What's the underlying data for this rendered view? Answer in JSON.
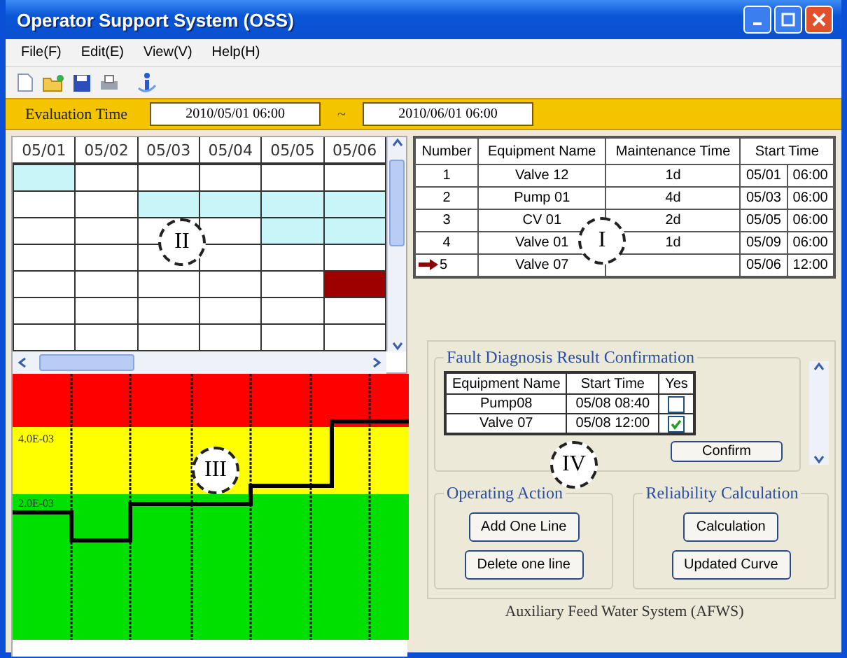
{
  "window": {
    "title": "Operator Support System (OSS)"
  },
  "menu": [
    "File(F)",
    "Edit(E)",
    "View(V)",
    "Help(H)"
  ],
  "evaluation": {
    "label": "Evaluation Time",
    "start": "2010/05/01 06:00",
    "separator": "~",
    "end": "2010/06/01 06:00"
  },
  "schedule": {
    "callout": "II",
    "columns": [
      "05/01",
      "05/02",
      "05/03",
      "05/04",
      "05/05",
      "05/06"
    ],
    "rows": [
      {
        "cells": [
          {
            "color": "#c8f5f7"
          },
          {
            "color": "#ffffff"
          },
          {
            "color": "#ffffff"
          },
          {
            "color": "#ffffff"
          },
          {
            "color": "#ffffff"
          },
          {
            "color": "#ffffff"
          }
        ]
      },
      {
        "cells": [
          {
            "color": "#ffffff"
          },
          {
            "color": "#ffffff"
          },
          {
            "color": "#c8f5f7"
          },
          {
            "color": "#c8f5f7"
          },
          {
            "color": "#c8f5f7"
          },
          {
            "color": "#c8f5f7"
          }
        ]
      },
      {
        "cells": [
          {
            "color": "#ffffff"
          },
          {
            "color": "#ffffff"
          },
          {
            "color": "#ffffff"
          },
          {
            "color": "#ffffff"
          },
          {
            "color": "#c8f5f7"
          },
          {
            "color": "#c8f5f7"
          }
        ]
      },
      {
        "cells": [
          {
            "color": "#ffffff"
          },
          {
            "color": "#ffffff"
          },
          {
            "color": "#ffffff"
          },
          {
            "color": "#ffffff"
          },
          {
            "color": "#ffffff"
          },
          {
            "color": "#ffffff"
          }
        ]
      },
      {
        "cells": [
          {
            "color": "#ffffff"
          },
          {
            "color": "#ffffff"
          },
          {
            "color": "#ffffff"
          },
          {
            "color": "#ffffff"
          },
          {
            "color": "#ffffff"
          },
          {
            "color": "#9e0000"
          }
        ]
      },
      {
        "cells": [
          {
            "color": "#ffffff"
          },
          {
            "color": "#ffffff"
          },
          {
            "color": "#ffffff"
          },
          {
            "color": "#ffffff"
          },
          {
            "color": "#ffffff"
          },
          {
            "color": "#ffffff"
          }
        ]
      },
      {
        "cells": [
          {
            "color": "#ffffff"
          },
          {
            "color": "#ffffff"
          },
          {
            "color": "#ffffff"
          },
          {
            "color": "#ffffff"
          },
          {
            "color": "#ffffff"
          },
          {
            "color": "#ffffff"
          }
        ]
      }
    ]
  },
  "reliability_chart": {
    "callout": "III",
    "band_labels": [
      "4.0E-03",
      "2.0E-03"
    ]
  },
  "maintenance_table": {
    "callout": "I",
    "columns": [
      "Number",
      "Equipment Name",
      "Maintenance Time",
      "Start Time"
    ],
    "rows": [
      {
        "number": "1",
        "equipment": "Valve 12",
        "maintenance": "1d",
        "date": "05/01",
        "time": "06:00",
        "current": false
      },
      {
        "number": "2",
        "equipment": "Pump 01",
        "maintenance": "4d",
        "date": "05/03",
        "time": "06:00",
        "current": false
      },
      {
        "number": "3",
        "equipment": "CV 01",
        "maintenance": "2d",
        "date": "05/05",
        "time": "06:00",
        "current": false
      },
      {
        "number": "4",
        "equipment": "Valve 01",
        "maintenance": "1d",
        "date": "05/09",
        "time": "06:00",
        "current": false
      },
      {
        "number": "5",
        "equipment": "Valve 07",
        "date": "05/06",
        "time": "12:00",
        "current": true
      }
    ]
  },
  "fault_diagnosis": {
    "title": "Fault Diagnosis Result Confirmation",
    "callout": "IV",
    "columns": [
      "Equipment Name",
      "Start Time",
      "Yes"
    ],
    "rows": [
      {
        "equipment": "Pump08",
        "start": "05/08 08:40",
        "checked": false
      },
      {
        "equipment": "Valve 07",
        "start": "05/08 12:00",
        "checked": true
      }
    ],
    "confirm": "Confirm"
  },
  "operating_action": {
    "title": "Operating Action",
    "buttons": [
      "Add One Line",
      "Delete one line"
    ]
  },
  "reliability_calculation": {
    "title": "Reliability Calculation",
    "buttons": [
      "Calculation",
      "Updated Curve"
    ]
  },
  "status": "Auxiliary Feed Water System  (AFWS)"
}
